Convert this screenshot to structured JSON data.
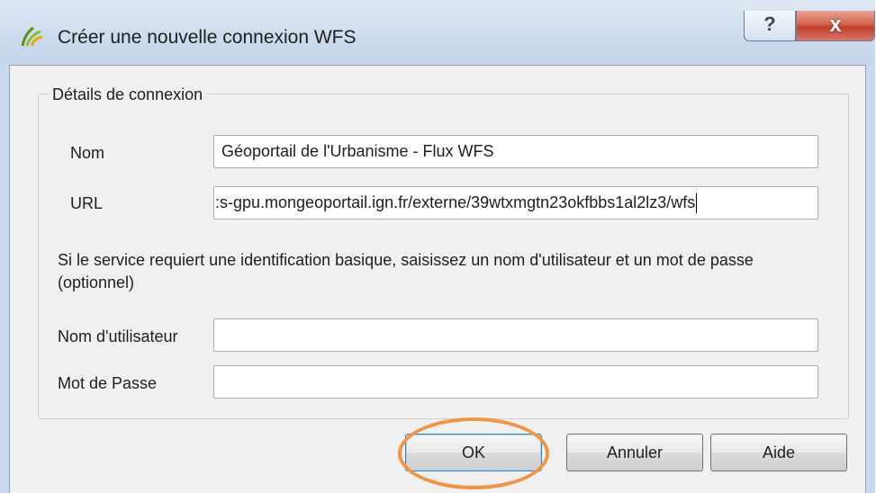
{
  "window": {
    "title": "Créer une nouvelle connexion WFS",
    "help_glyph": "?",
    "close_glyph": "x"
  },
  "group": {
    "legend": "Détails de connexion"
  },
  "form": {
    "name_label": "Nom",
    "name_value": "Géoportail de l'Urbanisme - Flux WFS",
    "url_label": "URL",
    "url_value": ":s-gpu.mongeoportail.ign.fr/externe/39wtxmgtn23okfbbs1al2lz3/wfs",
    "note": "Si le service requiert une identification basique, saisissez un nom d'utilisateur et un mot de passe (optionnel)",
    "user_label": "Nom d'utilisateur",
    "user_value": "",
    "password_label": "Mot de Passe",
    "password_value": ""
  },
  "buttons": {
    "ok": "OK",
    "cancel": "Annuler",
    "help": "Aide"
  },
  "colors": {
    "highlight": "#ef9545",
    "titlebar": "#cddcee",
    "close": "#c1402a"
  }
}
